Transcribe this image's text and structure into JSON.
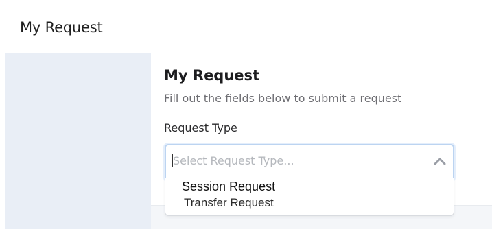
{
  "window": {
    "title": "My Request"
  },
  "form": {
    "title": "My Request",
    "subtitle": "Fill out the fields below to submit a request",
    "request_type": {
      "label": "Request Type",
      "placeholder": "Select Request Type...",
      "expanded": true,
      "options": [
        "Session Request",
        "Transfer Request"
      ]
    }
  },
  "icons": {
    "dropdown_toggle": "chevron-up-icon"
  },
  "colors": {
    "sidebar": "#e9eef6",
    "focus_border": "#bcd4f1",
    "placeholder": "#b5b8bd"
  }
}
